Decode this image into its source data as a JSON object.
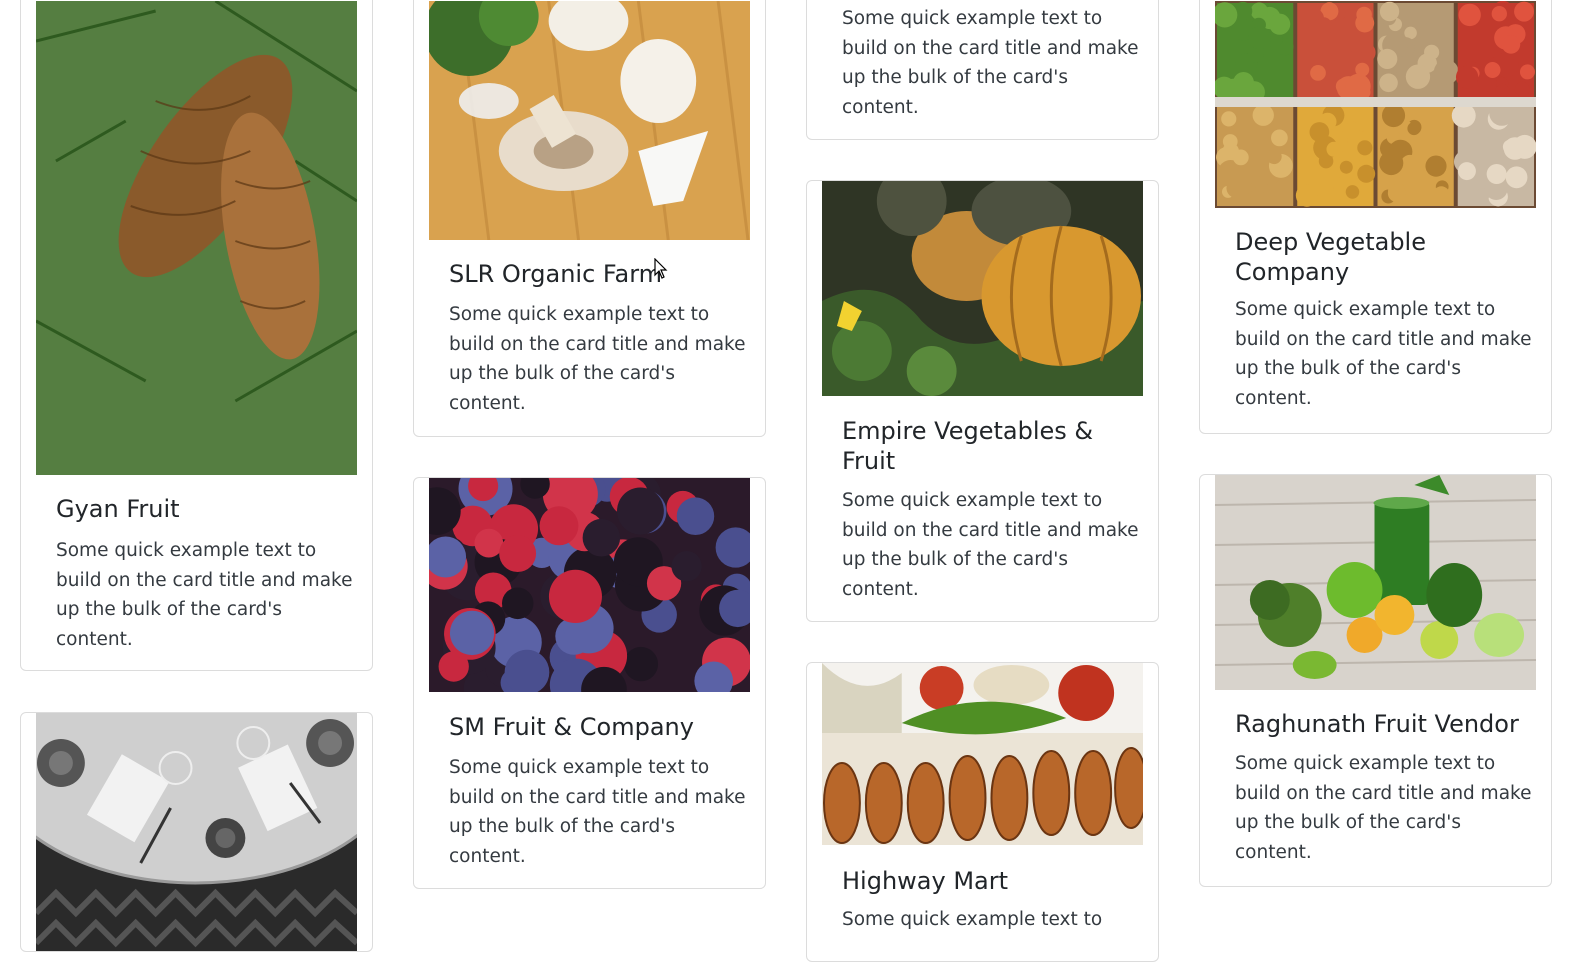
{
  "cards": [
    {
      "title": "Gyan Fruit",
      "text": "Some quick example text to build on the card title and make up the bulk of the card's content."
    },
    {
      "title": "",
      "text": ""
    },
    {
      "title": "SLR Organic Farm",
      "text": "Some quick example text to build on the card title and make up the bulk of the card's content."
    },
    {
      "title": "SM Fruit & Company",
      "text": "Some quick example text to build on the card title and make up the bulk of the card's content."
    },
    {
      "title": "",
      "text": "Some quick example text to build on the card title and make up the bulk of the card's content."
    },
    {
      "title": "Empire Vegetables & Fruit",
      "text": "Some quick example text to build on the card title and make up the bulk of the card's content."
    },
    {
      "title": "Highway Mart",
      "text": "Some quick example text to"
    },
    {
      "title": "Deep Vegetable Company",
      "text": "Some quick example text to build on the card title and make up the bulk of the card's content."
    },
    {
      "title": "Raghunath Fruit Vendor",
      "text": "Some quick example text to build on the card title and make up the bulk of the card's content."
    }
  ],
  "images": [
    {
      "subject": "pine-cones"
    },
    {
      "subject": "dining-table"
    },
    {
      "subject": "mushrooms"
    },
    {
      "subject": "berries"
    },
    {
      "subject": "pumpkins"
    },
    {
      "subject": "grilled-food"
    },
    {
      "subject": "vegetable-crates"
    },
    {
      "subject": "green-smoothie"
    }
  ]
}
